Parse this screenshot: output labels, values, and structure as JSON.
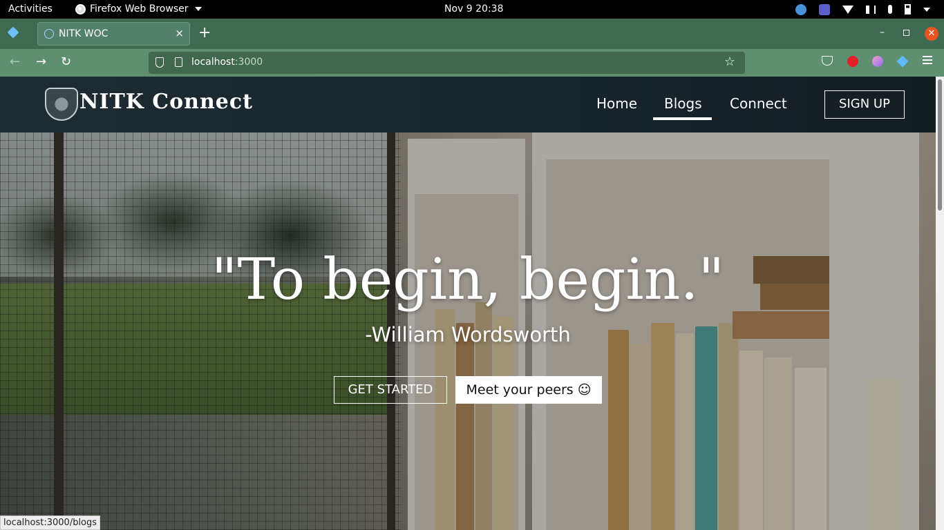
{
  "system": {
    "activities": "Activities",
    "app_name": "Firefox Web Browser",
    "clock": "Nov 9  20:38"
  },
  "browser": {
    "tab_title": "NITK WOC",
    "tab_close": "×",
    "new_tab": "+",
    "url_host": "localhost",
    "url_port": ":3000",
    "status_link": "localhost:3000/blogs"
  },
  "site": {
    "brand": "NITK Connect",
    "nav": {
      "home": "Home",
      "blogs": "Blogs",
      "connect": "Connect",
      "signup": "SIGN UP"
    },
    "active_nav": "Blogs"
  },
  "hero": {
    "quote": "\"To begin, begin.\"",
    "author": "-William Wordsworth",
    "get_started": "GET STARTED",
    "meet_peers": "Meet your peers ☺"
  },
  "colors": {
    "tabstrip": "#3e6a52",
    "navbar": "#5f8f71",
    "header": "#1e2b32",
    "close_button": "#e95420"
  }
}
